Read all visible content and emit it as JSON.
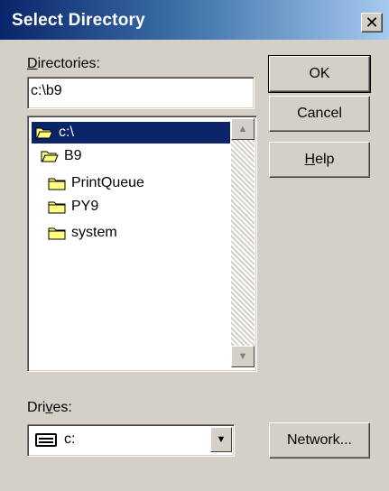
{
  "window": {
    "title": "Select Directory",
    "close_glyph": "✕"
  },
  "directories": {
    "label_prefix": "",
    "label_access": "D",
    "label_rest": "irectories:",
    "path_value": "c:\\b9",
    "items": [
      {
        "label": "c:\\",
        "icon": "open-folder-icon",
        "selected": true,
        "indent": 0
      },
      {
        "label": "B9",
        "icon": "open-folder-icon",
        "selected": false,
        "indent": 1
      },
      {
        "label": "PrintQueue",
        "icon": "folder-icon",
        "selected": false,
        "indent": 2
      },
      {
        "label": "PY9",
        "icon": "folder-icon",
        "selected": false,
        "indent": 2
      },
      {
        "label": "system",
        "icon": "folder-icon",
        "selected": false,
        "indent": 2
      }
    ]
  },
  "drives": {
    "label_prefix": "Dri",
    "label_access": "v",
    "label_rest": "es:",
    "selected": "c:",
    "icon": "hard-drive-icon"
  },
  "buttons": {
    "ok": "OK",
    "cancel": "Cancel",
    "help_access": "H",
    "help_rest": "elp",
    "network": "Network..."
  },
  "colors": {
    "title_active": "#0a246a",
    "title_fade": "#a6caf0",
    "face": "#d4d0c8",
    "selection": "#0a246a"
  }
}
